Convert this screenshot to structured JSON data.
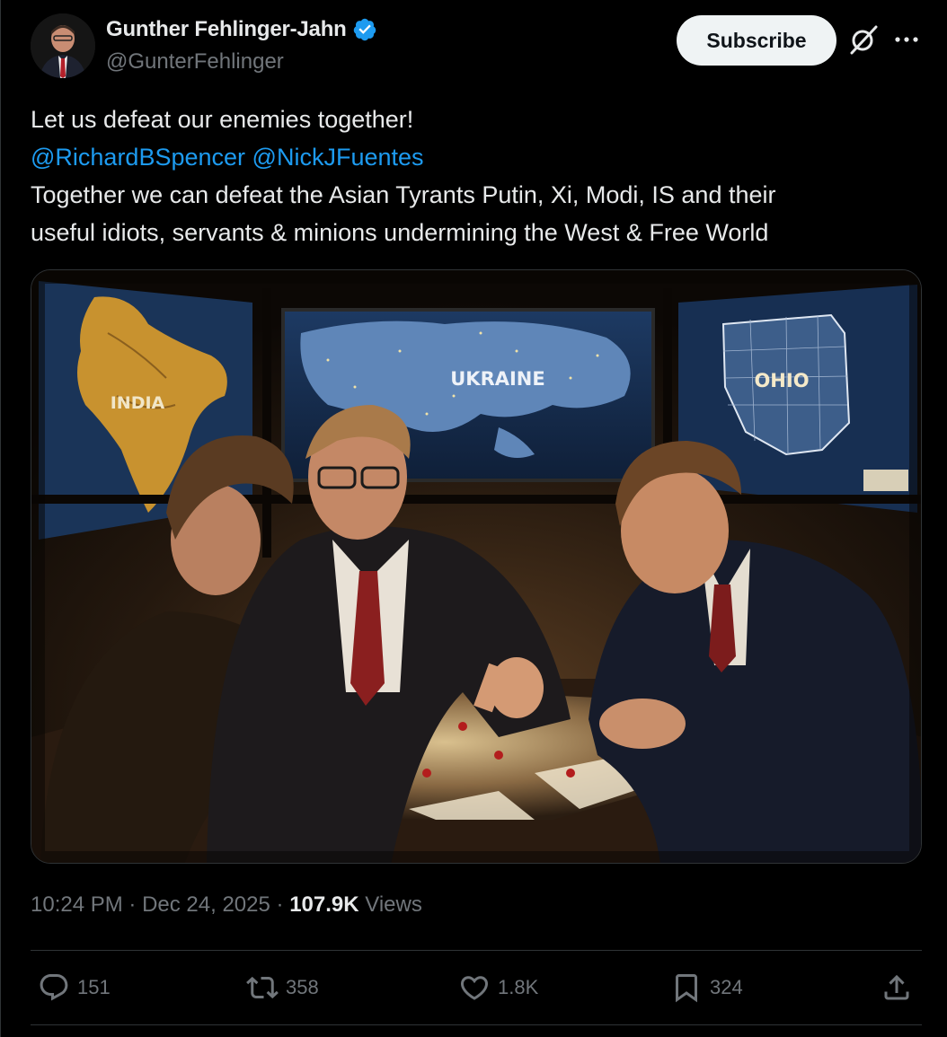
{
  "author": {
    "display_name": "Gunther Fehlinger-Jahn",
    "handle": "@GunterFehlinger",
    "verified": true,
    "verified_color": "#1d9bf0"
  },
  "header": {
    "subscribe_label": "Subscribe",
    "icons": [
      "grok-icon",
      "more-icon"
    ]
  },
  "tweet": {
    "line1": "Let us defeat our enemies together!",
    "mention1": "@RichardBSpencer",
    "mention2": "@NickJFuentes",
    "line3": "Together we can defeat the Asian Tyrants Putin, Xi, Modi, IS and their",
    "line4": "useful idiots, servants & minions undermining the West & Free World"
  },
  "media": {
    "map_labels": {
      "left": "INDIA",
      "center": "UKRAINE",
      "right": "OHIO"
    }
  },
  "meta": {
    "time": "10:24 PM",
    "separator": "·",
    "date": "Dec 24, 2025",
    "views_count": "107.9K",
    "views_label": "Views"
  },
  "actions": {
    "replies": "151",
    "reposts": "358",
    "likes": "1.8K",
    "bookmarks": "324"
  },
  "colors": {
    "background": "#000000",
    "text": "#e7e9ea",
    "secondary": "#71767b",
    "accent": "#1d9bf0",
    "divider": "#2f3336"
  }
}
